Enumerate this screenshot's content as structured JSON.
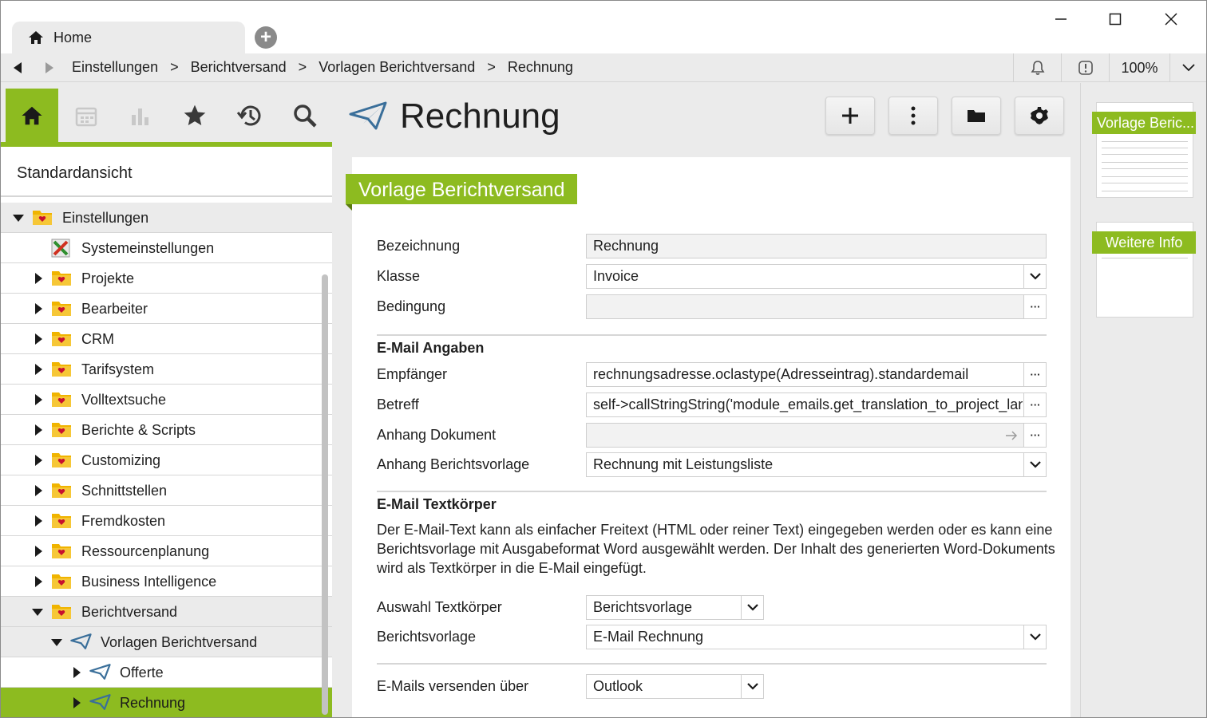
{
  "window": {
    "tab_title": "Home",
    "tab_icon": "home-icon",
    "new_tab_icon": "plus-circle-icon"
  },
  "navbar": {
    "breadcrumbs": [
      "Einstellungen",
      "Berichtversand",
      "Vorlagen Berichtversand",
      "Rechnung"
    ],
    "separator": ">",
    "zoom": "100%"
  },
  "sidebar": {
    "toolbar": [
      "home-icon",
      "calendar-icon",
      "bar-chart-icon",
      "star-icon",
      "history-icon",
      "search-icon"
    ],
    "view_name": "Standardansicht",
    "tree": [
      {
        "label": "Einstellungen",
        "level": 0,
        "state": "expanded",
        "icon": "folder-icon"
      },
      {
        "label": "Systemeinstellungen",
        "level": 1,
        "state": "leaf",
        "icon": "tools-icon"
      },
      {
        "label": "Projekte",
        "level": 1,
        "state": "collapsed",
        "icon": "folder-icon"
      },
      {
        "label": "Bearbeiter",
        "level": 1,
        "state": "collapsed",
        "icon": "folder-icon"
      },
      {
        "label": "CRM",
        "level": 1,
        "state": "collapsed",
        "icon": "folder-icon"
      },
      {
        "label": "Tarifsystem",
        "level": 1,
        "state": "collapsed",
        "icon": "folder-icon"
      },
      {
        "label": "Volltextsuche",
        "level": 1,
        "state": "collapsed",
        "icon": "folder-icon"
      },
      {
        "label": "Berichte & Scripts",
        "level": 1,
        "state": "collapsed",
        "icon": "folder-icon"
      },
      {
        "label": "Customizing",
        "level": 1,
        "state": "collapsed",
        "icon": "folder-icon"
      },
      {
        "label": "Schnittstellen",
        "level": 1,
        "state": "collapsed",
        "icon": "folder-icon"
      },
      {
        "label": "Fremdkosten",
        "level": 1,
        "state": "collapsed",
        "icon": "folder-icon"
      },
      {
        "label": "Ressourcenplanung",
        "level": 1,
        "state": "collapsed",
        "icon": "folder-icon"
      },
      {
        "label": "Business Intelligence",
        "level": 1,
        "state": "collapsed",
        "icon": "folder-icon"
      },
      {
        "label": "Berichtversand",
        "level": 1,
        "state": "expanded",
        "icon": "folder-icon"
      },
      {
        "label": "Vorlagen Berichtversand",
        "level": 2,
        "state": "expanded",
        "icon": "paper-plane-icon"
      },
      {
        "label": "Offerte",
        "level": 3,
        "state": "collapsed",
        "icon": "paper-plane-icon"
      },
      {
        "label": "Rechnung",
        "level": 3,
        "state": "collapsed",
        "icon": "paper-plane-icon",
        "selected": true
      }
    ]
  },
  "header": {
    "title": "Rechnung",
    "icon": "paper-plane-icon",
    "buttons": [
      "add-icon",
      "more-vertical-icon",
      "folder-icon",
      "settings-gear-icon"
    ]
  },
  "form": {
    "section_title": "Vorlage Berichtversand",
    "bezeichnung_label": "Bezeichnung",
    "bezeichnung_value": "Rechnung",
    "klasse_label": "Klasse",
    "klasse_value": "Invoice",
    "bedingung_label": "Bedingung",
    "bedingung_value": "",
    "email_heading": "E-Mail Angaben",
    "empfaenger_label": "Empfänger",
    "empfaenger_value": "rechnungsadresse.oclastype(Adresseintrag).standardemail",
    "betreff_label": "Betreff",
    "betreff_value": "self->callStringString('module_emails.get_translation_to_project_lang",
    "anhang_dok_label": "Anhang Dokument",
    "anhang_dok_value": "",
    "anhang_vorlage_label": "Anhang Berichtsvorlage",
    "anhang_vorlage_value": "Rechnung mit Leistungsliste",
    "body_heading": "E-Mail Textkörper",
    "body_description": "Der E-Mail-Text kann als einfacher Freitext (HTML oder reiner Text) eingegeben werden oder es kann eine Berichtsvorlage mit Ausgabeformat Word ausgewählt werden. Der Inhalt des generierten Word-Dokuments wird als Textkörper in die E-Mail eingefügt.",
    "auswahl_label": "Auswahl Textkörper",
    "auswahl_value": "Berichtsvorlage",
    "berichtsvorlage_label": "Berichtsvorlage",
    "berichtsvorlage_value": "E-Mail Rechnung",
    "versenden_label": "E-Mails versenden über",
    "versenden_value": "Outlook",
    "ellipsis": "···"
  },
  "right_panel": {
    "thumb1_title": "Vorlage Beric...",
    "thumb2_title": "Weitere Info"
  },
  "colors": {
    "accent": "#8dbb20",
    "folder": "#f0b400"
  }
}
